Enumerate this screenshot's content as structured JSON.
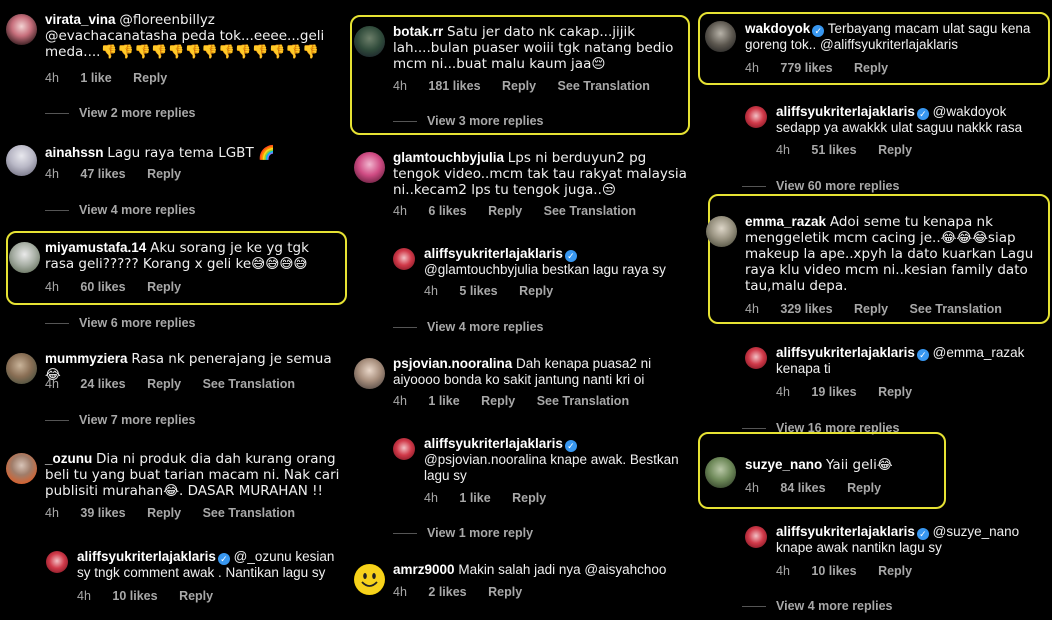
{
  "colors": {
    "highlight": "#e6e233",
    "verified": "#3897f0",
    "meta": "#a8a8a8"
  },
  "col1": {
    "c1": {
      "user": "virata_vina",
      "text": "@floreenbillyz @evachacanatasha peda tok...eeee...geli meda....👎👎👎👎👎👎👎👎👎👎👎👎👎",
      "age": "4h",
      "likes": "1 like",
      "reply": "Reply"
    },
    "v1": "View 2 more replies",
    "c2": {
      "user": "ainahssn",
      "text": "Lagu raya tema LGBT 🌈",
      "age": "4h",
      "likes": "47 likes",
      "reply": "Reply"
    },
    "v2": "View 4 more replies",
    "c3": {
      "user": "miyamustafa.14",
      "text": "Aku sorang je ke yg tgk rasa geli????? Korang x geli ke😅😅😅😅",
      "age": "4h",
      "likes": "60 likes",
      "reply": "Reply"
    },
    "v3": "View 6 more replies",
    "c4": {
      "user": "mummyziera",
      "text": "Rasa nk penerajang je semua 😂",
      "age": "4h",
      "likes": "24 likes",
      "reply": "Reply",
      "translate": "See Translation"
    },
    "v4": "View 7 more replies",
    "c5": {
      "user": "_ozunu",
      "text": "Dia ni produk dia dah kurang orang beli tu yang buat tarian macam ni. Nak cari publisiti murahan😂. DASAR MURAHAN !!",
      "age": "4h",
      "likes": "39 likes",
      "reply": "Reply",
      "translate": "See Translation"
    },
    "r5": {
      "user": "aliffsyukriterlajaklaris",
      "text": "@_ozunu kesian sy tngk comment awak .  Nantikan lagu sy",
      "age": "4h",
      "likes": "10 likes",
      "reply": "Reply"
    }
  },
  "col2": {
    "c1": {
      "user": "botak.rr",
      "text": "Satu jer dato nk cakap...jijik lah....bulan puaser woiii tgk natang bedio mcm ni...buat malu kaum jaa😔",
      "age": "4h",
      "likes": "181 likes",
      "reply": "Reply",
      "translate": "See Translation"
    },
    "v1": "View 3 more replies",
    "c2": {
      "user": "glamtouchbyjulia",
      "text": "Lps ni berduyun2 pg tengok video..mcm tak tau rakyat malaysia ni..kecam2 lps tu tengok juga..😒",
      "age": "4h",
      "likes": "6 likes",
      "reply": "Reply",
      "translate": "See Translation"
    },
    "r2": {
      "user": "aliffsyukriterlajaklaris",
      "text": "@glamtouchbyjulia bestkan lagu raya sy",
      "age": "4h",
      "likes": "5 likes",
      "reply": "Reply"
    },
    "v2": "View 4 more replies",
    "c3": {
      "user": "psjovian.nooralina",
      "text": "Dah kenapa puasa2 ni aiyoooo bonda ko sakit jantung nanti kri oi",
      "age": "4h",
      "likes": "1 like",
      "reply": "Reply",
      "translate": "See Translation"
    },
    "r3": {
      "user": "aliffsyukriterlajaklaris",
      "text": "@psjovian.nooralina knape awak. Bestkan lagu sy",
      "age": "4h",
      "likes": "1 like",
      "reply": "Reply"
    },
    "v3": "View 1 more reply",
    "c4": {
      "user": "amrz9000",
      "text": "Makin salah jadi nya @aisyahchoo",
      "age": "4h",
      "likes": "2 likes",
      "reply": "Reply"
    }
  },
  "col3": {
    "c1": {
      "user": "wakdoyok",
      "text": "Terbayang macam ulat sagu kena goreng tok.. @aliffsyukriterlajaklaris",
      "age": "4h",
      "likes": "779 likes",
      "reply": "Reply"
    },
    "r1": {
      "user": "aliffsyukriterlajaklaris",
      "text": "@wakdoyok sedapp ya awakkk ulat saguu nakkk rasa",
      "age": "4h",
      "likes": "51 likes",
      "reply": "Reply"
    },
    "v1": "View 60 more replies",
    "c2": {
      "user": "emma_razak",
      "text": "Adoi seme tu kenapa nk menggeletik mcm cacing je..😂😂😂siap makeup la ape..xpyh la dato kuarkan Lagu raya klu video mcm ni..kesian family dato tau,malu depa.",
      "age": "4h",
      "likes": "329 likes",
      "reply": "Reply",
      "translate": "See Translation"
    },
    "r2": {
      "user": "aliffsyukriterlajaklaris",
      "text": "@emma_razak kenapa ti",
      "age": "4h",
      "likes": "19 likes",
      "reply": "Reply"
    },
    "v2": "View 16 more replies",
    "c3": {
      "user": "suzye_nano",
      "text": "Yaii geli😂",
      "age": "4h",
      "likes": "84 likes",
      "reply": "Reply"
    },
    "r3": {
      "user": "aliffsyukriterlajaklaris",
      "text": "@suzye_nano knape awak nantikn lagu sy",
      "age": "4h",
      "likes": "10 likes",
      "reply": "Reply"
    },
    "v3": "View 4 more replies"
  }
}
